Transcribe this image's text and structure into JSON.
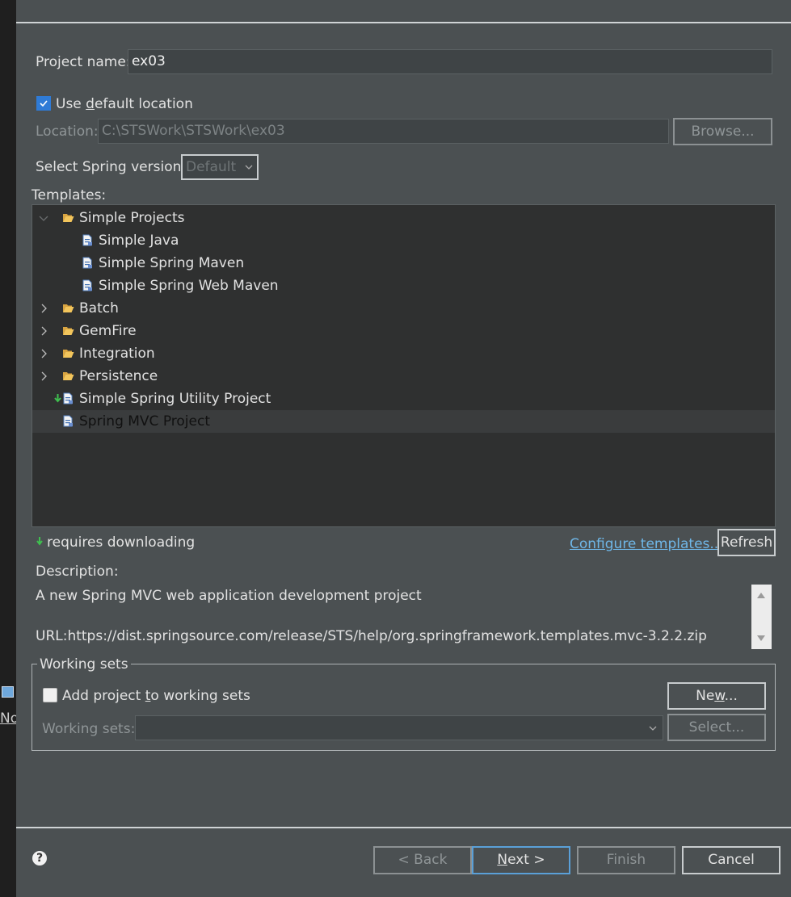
{
  "form": {
    "project_name_label": "Project name:",
    "project_name_value": "ex03",
    "use_default_location": {
      "label_pre": "Use ",
      "mnemonic": "d",
      "label_post": "efault location",
      "checked": true
    },
    "location_label": "Location:",
    "location_value": "C:\\STSWork\\STSWork\\ex03",
    "browse_label": "Browse...",
    "spring_version_label": "Select Spring version:",
    "spring_version_value": "Default"
  },
  "templates": {
    "heading": "Templates:",
    "items": [
      {
        "label": "Simple Projects",
        "type": "folder",
        "expanded": true
      },
      {
        "label": "Simple Java",
        "type": "file"
      },
      {
        "label": "Simple Spring Maven",
        "type": "file"
      },
      {
        "label": "Simple Spring Web Maven",
        "type": "file"
      },
      {
        "label": "Batch",
        "type": "folder",
        "expanded": false
      },
      {
        "label": "GemFire",
        "type": "folder",
        "expanded": false
      },
      {
        "label": "Integration",
        "type": "folder",
        "expanded": false
      },
      {
        "label": "Persistence",
        "type": "folder",
        "expanded": false
      },
      {
        "label": "Simple Spring Utility Project",
        "type": "file-download"
      },
      {
        "label": "Spring MVC Project",
        "type": "file",
        "selected": true
      }
    ],
    "requires_downloading_label": "requires downloading",
    "configure_link": "Configure templates...",
    "refresh_label": "Refresh"
  },
  "description": {
    "heading": "Description:",
    "text": "A new Spring MVC web application development project",
    "url": "URL:https://dist.springsource.com/release/STS/help/org.springframework.templates.mvc-3.2.2.zip"
  },
  "working_sets": {
    "title": "Working sets",
    "add_label_pre": "Add project ",
    "add_mnemonic": "t",
    "add_label_post": "o working sets",
    "add_checked": false,
    "new_pre": "Ne",
    "new_mnemonic": "w",
    "new_post": "...",
    "sets_label": "Working sets:",
    "sets_value": "",
    "select_label": "Select..."
  },
  "buttons": {
    "back": "< Back",
    "next_mnemonic": "N",
    "next_rest": "ext >",
    "finish": "Finish",
    "cancel": "Cancel",
    "help": "?"
  },
  "background": {
    "partial_label": "No"
  },
  "colors": {
    "dialog_bg": "#4b5052",
    "tree_bg": "#2f3030",
    "accent": "#2f7bd6",
    "link": "#6fb7e8"
  }
}
